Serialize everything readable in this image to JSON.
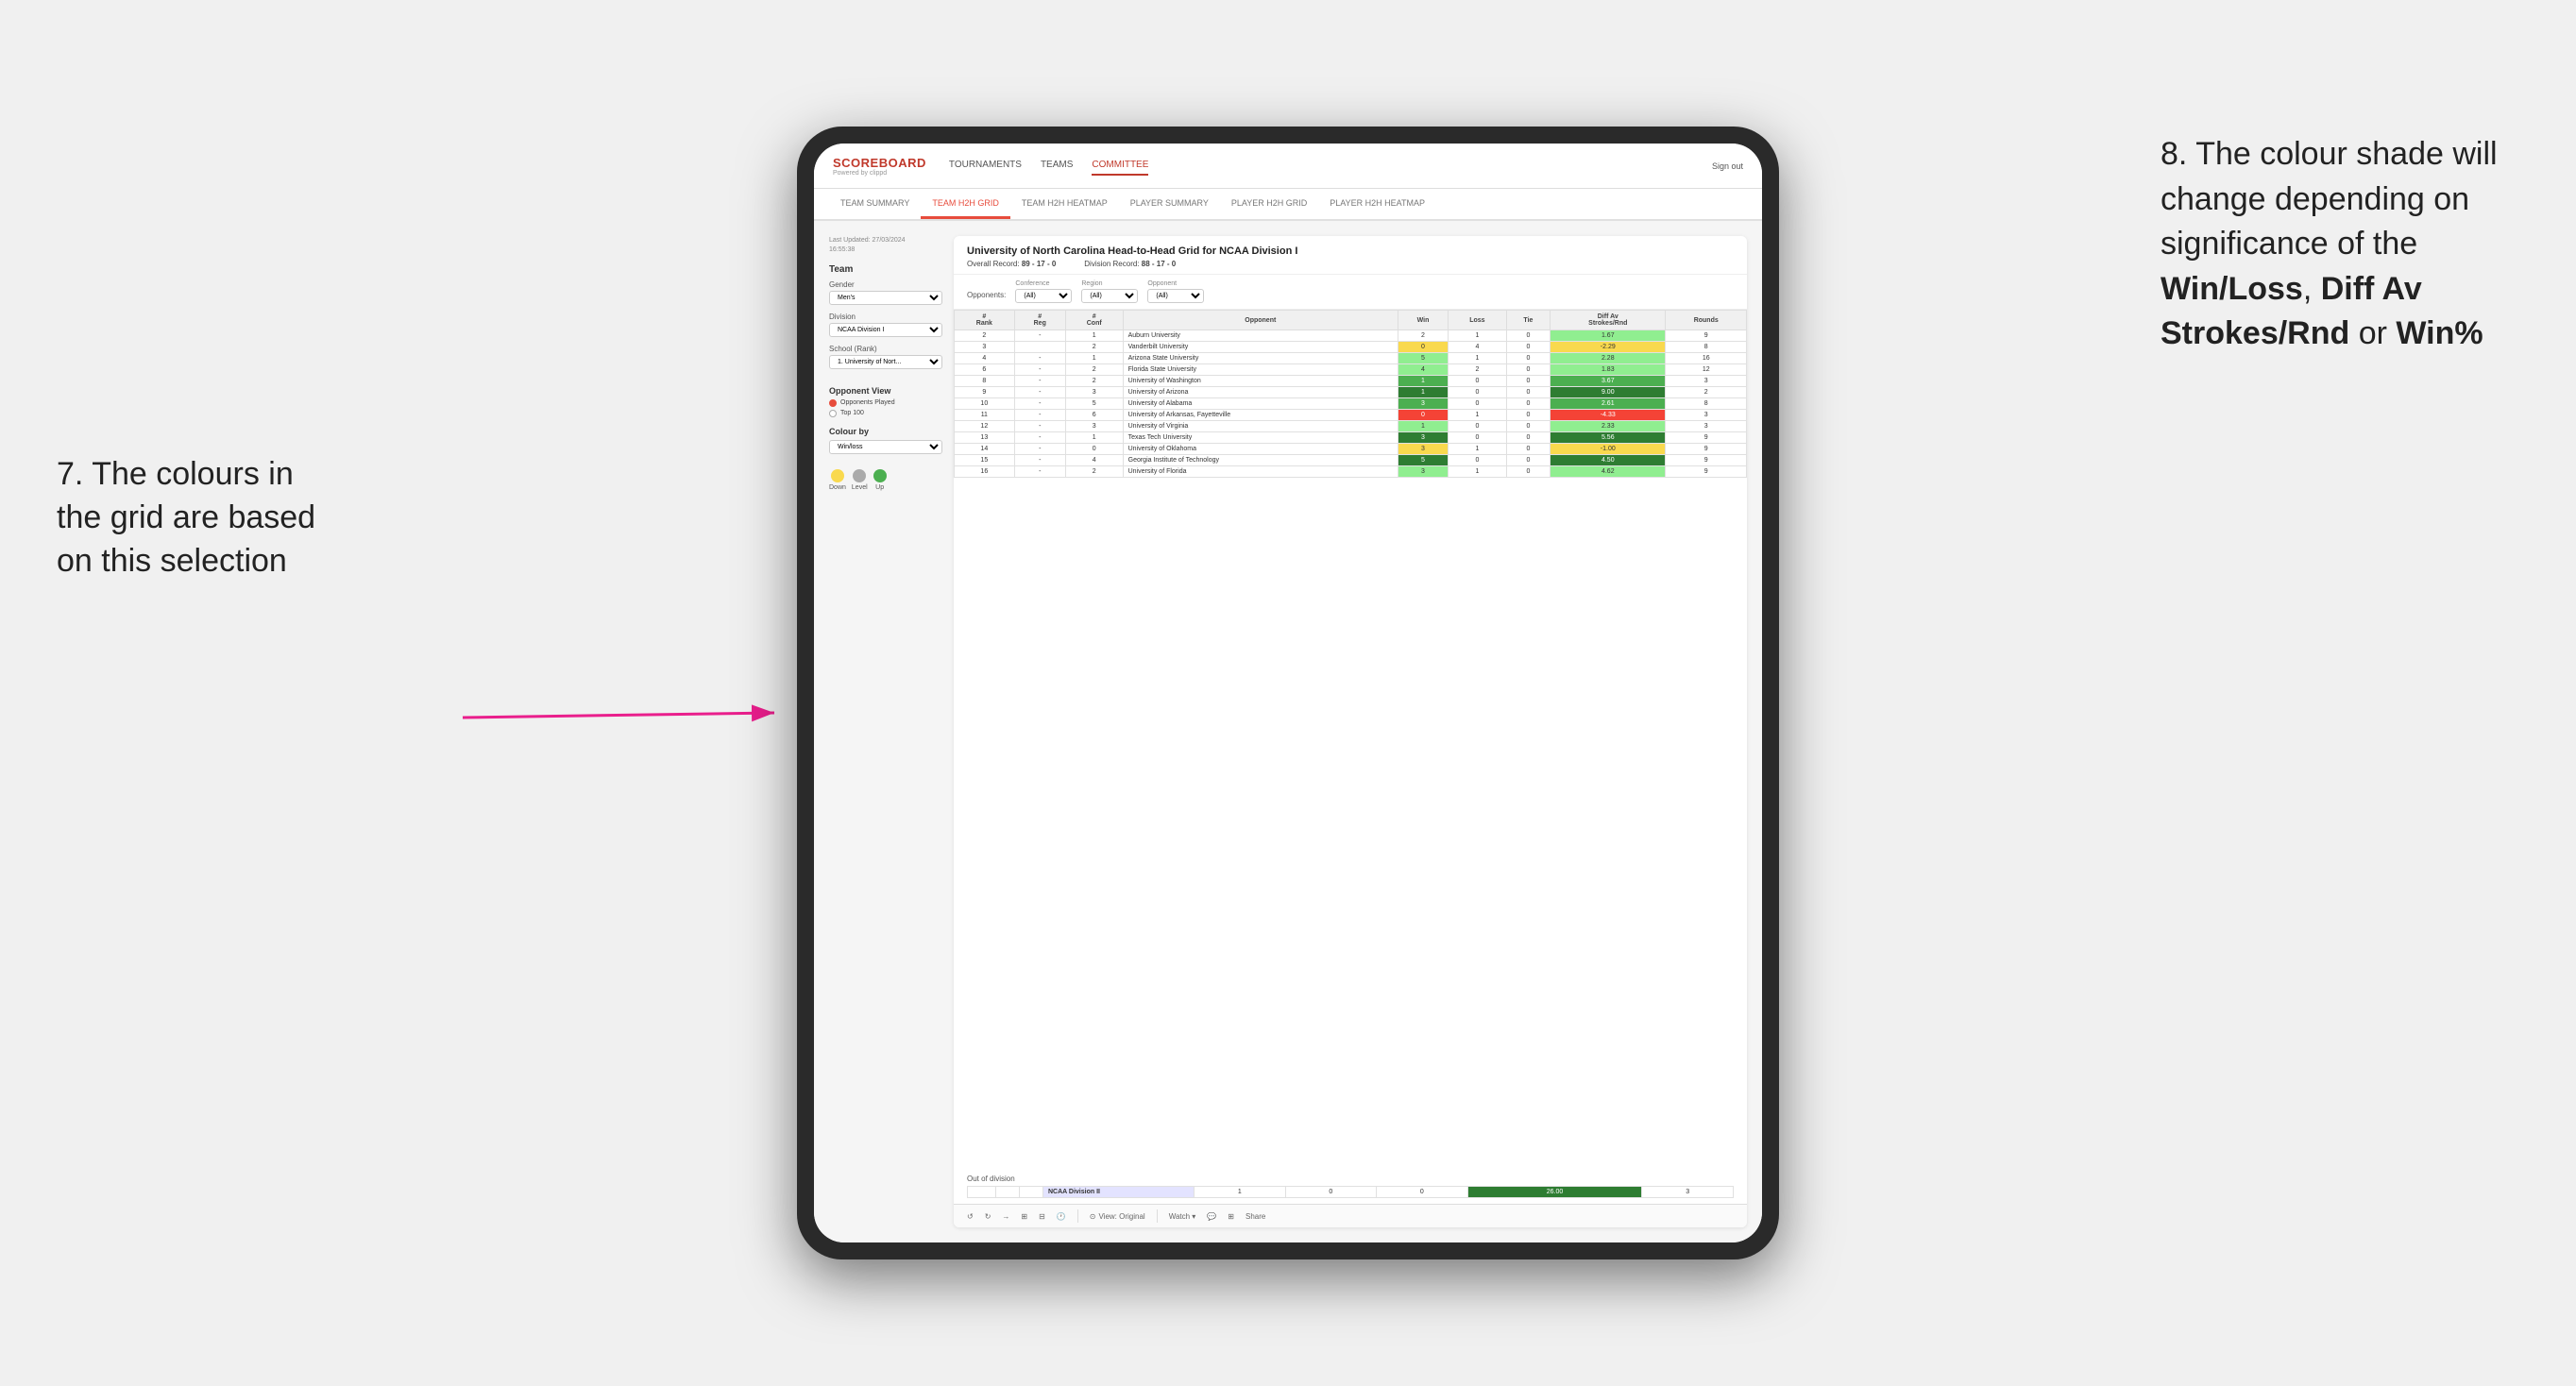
{
  "annotations": {
    "left_text": "7. The colours in the grid are based on this selection",
    "right_text_1": "8. The colour shade will change depending on significance of the ",
    "right_bold_1": "Win/Loss",
    "right_text_2": ", ",
    "right_bold_2": "Diff Av Strokes/Rnd",
    "right_text_3": " or ",
    "right_bold_3": "Win%"
  },
  "nav": {
    "logo": "SCOREBOARD",
    "logo_sub": "Powered by clippd",
    "items": [
      "TOURNAMENTS",
      "TEAMS",
      "COMMITTEE"
    ],
    "active_item": "COMMITTEE",
    "sign_out": "Sign out"
  },
  "sub_nav": {
    "items": [
      "TEAM SUMMARY",
      "TEAM H2H GRID",
      "TEAM H2H HEATMAP",
      "PLAYER SUMMARY",
      "PLAYER H2H GRID",
      "PLAYER H2H HEATMAP"
    ],
    "active": "TEAM H2H GRID"
  },
  "sidebar": {
    "last_updated_label": "Last Updated: 27/03/2024",
    "last_updated_time": "16:55:38",
    "team_section": "Team",
    "gender_label": "Gender",
    "gender_value": "Men's",
    "division_label": "Division",
    "division_value": "NCAA Division I",
    "school_label": "School (Rank)",
    "school_value": "1. University of Nort...",
    "opponent_view_title": "Opponent View",
    "radio_options": [
      "Opponents Played",
      "Top 100"
    ],
    "radio_selected": "Opponents Played",
    "colour_by_title": "Colour by",
    "colour_by_value": "Win/loss",
    "legend": [
      {
        "label": "Down",
        "color": "#f9d94e"
      },
      {
        "label": "Level",
        "color": "#aaaaaa"
      },
      {
        "label": "Up",
        "color": "#4caf50"
      }
    ]
  },
  "grid": {
    "title": "University of North Carolina Head-to-Head Grid for NCAA Division I",
    "overall_record_label": "Overall Record:",
    "overall_record_value": "89 - 17 - 0",
    "division_record_label": "Division Record:",
    "division_record_value": "88 - 17 - 0",
    "filter_opponents_label": "Opponents:",
    "filter_conference_label": "Conference",
    "filter_conference_value": "(All)",
    "filter_region_label": "Region",
    "filter_region_value": "(All)",
    "filter_opponent_label": "Opponent",
    "filter_opponent_value": "(All)",
    "columns": [
      "#\nRank",
      "#\nReg",
      "#\nConf",
      "Opponent",
      "Win",
      "Loss",
      "Tie",
      "Diff Av\nStrokes/Rnd",
      "Rounds"
    ],
    "rows": [
      {
        "rank": "2",
        "reg": "-",
        "conf": "1",
        "opponent": "Auburn University",
        "win": "2",
        "loss": "1",
        "tie": "0",
        "diff": "1.67",
        "rounds": "9",
        "win_color": "",
        "diff_color": "cell-light-green"
      },
      {
        "rank": "3",
        "reg": "",
        "conf": "2",
        "opponent": "Vanderbilt University",
        "win": "0",
        "loss": "4",
        "tie": "0",
        "diff": "-2.29",
        "rounds": "8",
        "win_color": "cell-yellow",
        "diff_color": "cell-yellow"
      },
      {
        "rank": "4",
        "reg": "-",
        "conf": "1",
        "opponent": "Arizona State University",
        "win": "5",
        "loss": "1",
        "tie": "0",
        "diff": "2.28",
        "rounds": "16",
        "win_color": "cell-light-green",
        "diff_color": "cell-light-green"
      },
      {
        "rank": "6",
        "reg": "-",
        "conf": "2",
        "opponent": "Florida State University",
        "win": "4",
        "loss": "2",
        "tie": "0",
        "diff": "1.83",
        "rounds": "12",
        "win_color": "cell-light-green",
        "diff_color": "cell-light-green"
      },
      {
        "rank": "8",
        "reg": "-",
        "conf": "2",
        "opponent": "University of Washington",
        "win": "1",
        "loss": "0",
        "tie": "0",
        "diff": "3.67",
        "rounds": "3",
        "win_color": "cell-green",
        "diff_color": "cell-green"
      },
      {
        "rank": "9",
        "reg": "-",
        "conf": "3",
        "opponent": "University of Arizona",
        "win": "1",
        "loss": "0",
        "tie": "0",
        "diff": "9.00",
        "rounds": "2",
        "win_color": "cell-dark-green",
        "diff_color": "cell-dark-green"
      },
      {
        "rank": "10",
        "reg": "-",
        "conf": "5",
        "opponent": "University of Alabama",
        "win": "3",
        "loss": "0",
        "tie": "0",
        "diff": "2.61",
        "rounds": "8",
        "win_color": "cell-green",
        "diff_color": "cell-green"
      },
      {
        "rank": "11",
        "reg": "-",
        "conf": "6",
        "opponent": "University of Arkansas, Fayetteville",
        "win": "0",
        "loss": "1",
        "tie": "0",
        "diff": "-4.33",
        "rounds": "3",
        "win_color": "cell-red",
        "diff_color": "cell-red"
      },
      {
        "rank": "12",
        "reg": "-",
        "conf": "3",
        "opponent": "University of Virginia",
        "win": "1",
        "loss": "0",
        "tie": "0",
        "diff": "2.33",
        "rounds": "3",
        "win_color": "cell-light-green",
        "diff_color": "cell-light-green"
      },
      {
        "rank": "13",
        "reg": "-",
        "conf": "1",
        "opponent": "Texas Tech University",
        "win": "3",
        "loss": "0",
        "tie": "0",
        "diff": "5.56",
        "rounds": "9",
        "win_color": "cell-dark-green",
        "diff_color": "cell-dark-green"
      },
      {
        "rank": "14",
        "reg": "-",
        "conf": "0",
        "opponent": "University of Oklahoma",
        "win": "3",
        "loss": "1",
        "tie": "0",
        "diff": "-1.00",
        "rounds": "9",
        "win_color": "cell-yellow",
        "diff_color": "cell-yellow"
      },
      {
        "rank": "15",
        "reg": "-",
        "conf": "4",
        "opponent": "Georgia Institute of Technology",
        "win": "5",
        "loss": "0",
        "tie": "0",
        "diff": "4.50",
        "rounds": "9",
        "win_color": "cell-dark-green",
        "diff_color": "cell-dark-green"
      },
      {
        "rank": "16",
        "reg": "-",
        "conf": "2",
        "opponent": "University of Florida",
        "win": "3",
        "loss": "1",
        "tie": "0",
        "diff": "4.62",
        "rounds": "9",
        "win_color": "cell-light-green",
        "diff_color": "cell-light-green"
      }
    ],
    "out_division_label": "Out of division",
    "out_division_row": {
      "name": "NCAA Division II",
      "win": "1",
      "loss": "0",
      "tie": "0",
      "diff": "26.00",
      "rounds": "3",
      "diff_color": "cell-dark-green"
    }
  },
  "toolbar": {
    "view_label": "View: Original",
    "watch_label": "Watch ▾",
    "share_label": "Share"
  }
}
